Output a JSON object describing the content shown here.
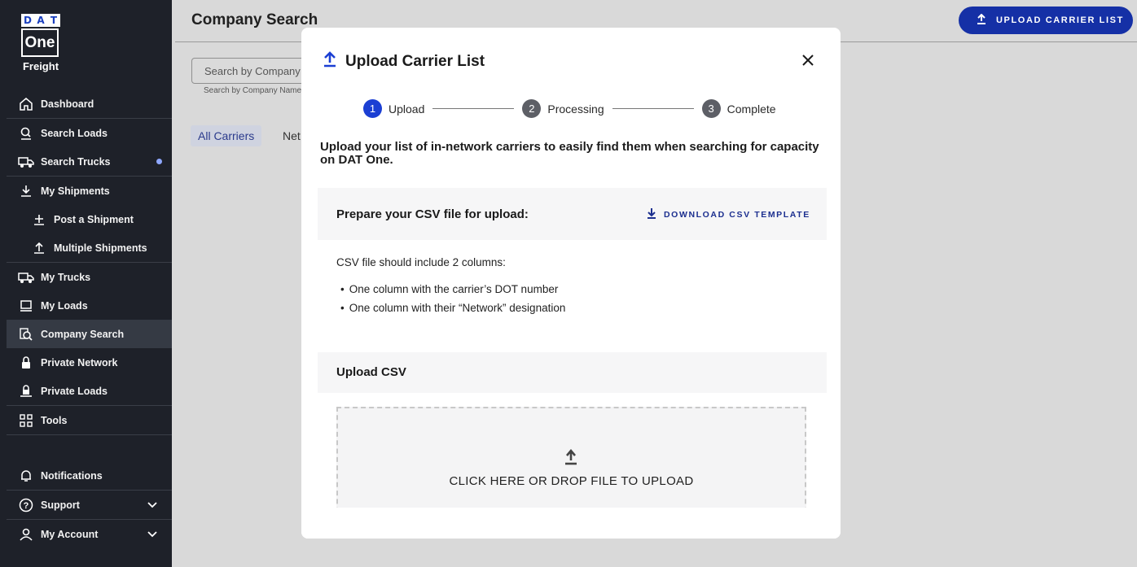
{
  "logo": {
    "letters": [
      "D",
      "A",
      "T"
    ],
    "product": "One",
    "subtitle": "Freight"
  },
  "sidebar": {
    "items": [
      {
        "label": "Dashboard",
        "icon": "home-icon"
      },
      {
        "label": "Search Loads",
        "icon": "search-loads-icon"
      },
      {
        "label": "Search Trucks",
        "icon": "truck-search-icon"
      },
      {
        "label": "My Shipments",
        "icon": "download-icon"
      },
      {
        "label": "Post a Shipment",
        "icon": "post-icon"
      },
      {
        "label": "Multiple Shipments",
        "icon": "upload-icon"
      },
      {
        "label": "My Trucks",
        "icon": "truck-icon"
      },
      {
        "label": "My Loads",
        "icon": "loads-icon"
      },
      {
        "label": "Company Search",
        "icon": "company-search-icon"
      },
      {
        "label": "Private Network",
        "icon": "lock-icon"
      },
      {
        "label": "Private Loads",
        "icon": "private-loads-icon"
      },
      {
        "label": "Tools",
        "icon": "grid-icon"
      }
    ],
    "bottom": [
      {
        "label": "Notifications",
        "icon": "bell-icon"
      },
      {
        "label": "Support",
        "icon": "help-icon"
      },
      {
        "label": "My Account",
        "icon": "user-icon"
      }
    ]
  },
  "header": {
    "title": "Company Search",
    "upload_label": "UPLOAD CARRIER LIST"
  },
  "search": {
    "placeholder": "Search by Company Name",
    "help": "Search by Company Name"
  },
  "tabs": {
    "all": "All Carriers",
    "network": "Network"
  },
  "modal": {
    "title": "Upload Carrier List",
    "steps": [
      {
        "num": "1",
        "label": "Upload"
      },
      {
        "num": "2",
        "label": "Processing"
      },
      {
        "num": "3",
        "label": "Complete"
      }
    ],
    "intro": "Upload your list of in-network carriers to easily find them when searching for capacity on DAT One.",
    "prep_title": "Prepare your CSV file for upload:",
    "download_label": "DOWNLOAD CSV TEMPLATE",
    "csv_note": "CSV file should include 2 columns:",
    "bullets": [
      "One column with the carrier’s DOT number",
      "One column with their “Network” designation"
    ],
    "upload_title": "Upload CSV",
    "drop_label": "CLICK HERE OR DROP FILE TO UPLOAD"
  },
  "colors": {
    "brand": "#1530a6",
    "sidebar": "#1e2129",
    "active_step": "#1b3fd3"
  }
}
